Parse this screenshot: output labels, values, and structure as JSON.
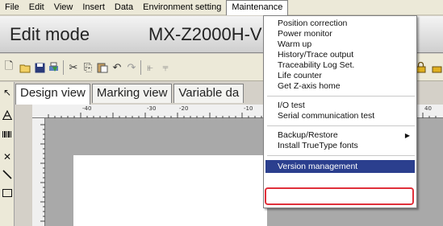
{
  "menubar": {
    "items": [
      "File",
      "Edit",
      "View",
      "Insert",
      "Data",
      "Environment setting",
      "Maintenance"
    ]
  },
  "titlebar": {
    "mode": "Edit mode",
    "model": "MX-Z2000H-V"
  },
  "tabs": [
    "Design view",
    "Marking view",
    "Variable da"
  ],
  "ruler": {
    "top_labels": [
      "-40",
      "-30",
      "-20",
      "-10",
      "40"
    ]
  },
  "maintenance_menu": {
    "group1": [
      "Position correction",
      "Power monitor",
      "Warm up",
      "History/Trace output",
      "Traceability Log Set.",
      "Life counter",
      "Get Z-axis home"
    ],
    "group2": [
      "I/O test",
      "Serial communication test"
    ],
    "group3": [
      "Backup/Restore",
      "Install TrueType fonts"
    ],
    "selected": "Version management"
  },
  "icons": {
    "toolbar": [
      "new-icon",
      "open-icon",
      "save-icon",
      "print-icon",
      "cut-icon",
      "copy-icon",
      "paste-icon",
      "undo-icon",
      "redo-icon",
      "align-icon",
      "lock-icon"
    ],
    "palette": [
      "pointer-icon",
      "text-icon",
      "barcode-icon",
      "cross-icon",
      "line-icon",
      "rectangle-icon"
    ]
  },
  "colors": {
    "highlight_bg": "#2b3f8e",
    "annotation_border": "#e0303a"
  }
}
